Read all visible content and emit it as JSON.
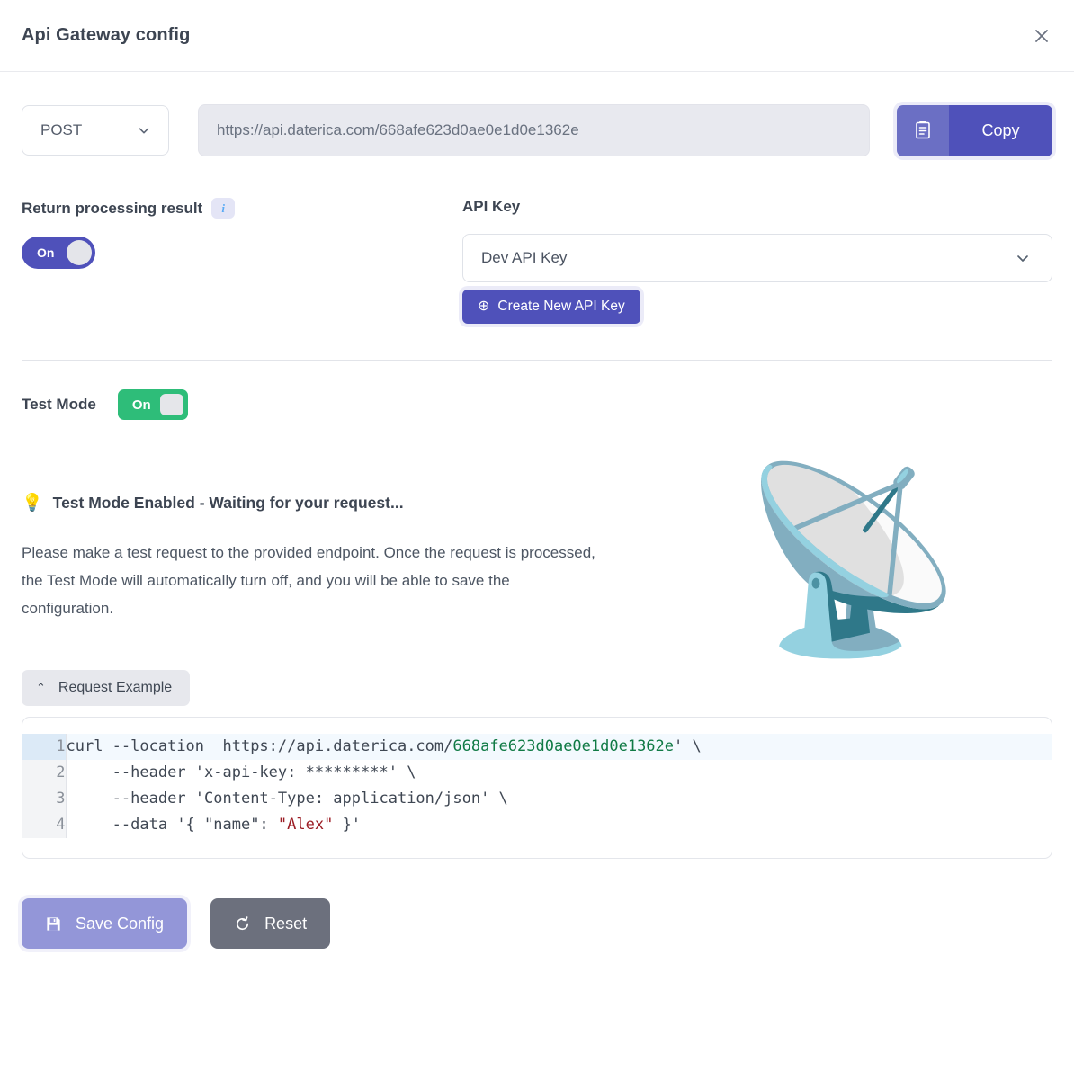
{
  "header": {
    "title": "Api Gateway config",
    "close_icon": "close-icon"
  },
  "endpoint": {
    "method": "POST",
    "method_chevron_icon": "chevron-down-icon",
    "url": "https://api.daterica.com/668afe623d0ae0e1d0e1362e",
    "copy_label": "Copy",
    "copy_icon": "clipboard-icon"
  },
  "return_processing": {
    "label": "Return processing result",
    "info_icon": "info-icon",
    "info_glyph": "i",
    "toggle_state": "On"
  },
  "api_key": {
    "label": "API Key",
    "selected": "Dev API Key",
    "chevron_icon": "chevron-down-icon",
    "create_button": "Create New API Key",
    "create_icon": "circle-plus-icon",
    "create_glyph": "⊕"
  },
  "test_mode": {
    "label": "Test Mode",
    "toggle_state": "On"
  },
  "test_panel": {
    "bulb_icon": "lightbulb-icon",
    "bulb_glyph": "💡",
    "heading": "Test Mode Enabled - Waiting for your request...",
    "body": "Please make a test request to the provided endpoint. Once the request is processed, the Test Mode will automatically turn off, and you will be able to save the configuration.",
    "art_icon": "satellite-dish-illustration",
    "art_glyph": "📡"
  },
  "request_example": {
    "toggle_label": "Request Example",
    "caret_icon": "chevron-up-icon",
    "caret_glyph": "⌃",
    "lines": [
      {
        "n": "1",
        "highlight": true,
        "pre": "curl --location  https://api.daterica.com/",
        "hash": "668afe623d0ae0e1d0e1362e",
        "post": "' \\"
      },
      {
        "n": "2",
        "highlight": false,
        "pre": "     --header 'x-api-key: *********' \\",
        "hash": "",
        "post": ""
      },
      {
        "n": "3",
        "highlight": false,
        "pre": "     --header 'Content-Type: application/json' \\",
        "hash": "",
        "post": ""
      },
      {
        "n": "4",
        "highlight": false,
        "pre": "     --data '{ \"name\": ",
        "str": "\"Alex\"",
        "post2": " }'"
      }
    ]
  },
  "footer": {
    "save_label": "Save Config",
    "save_icon": "save-disk-icon",
    "reset_label": "Reset",
    "reset_icon": "reset-arrow-icon"
  },
  "colors": {
    "primary_purple": "#4f51ba",
    "copy_icon_purple": "#6b6fc4",
    "toggle_green": "#2ebd79",
    "save_disabled": "#9396d8",
    "reset_gray": "#6c707d",
    "code_hash_green": "#107a45",
    "code_string_red": "#9b1c24"
  }
}
